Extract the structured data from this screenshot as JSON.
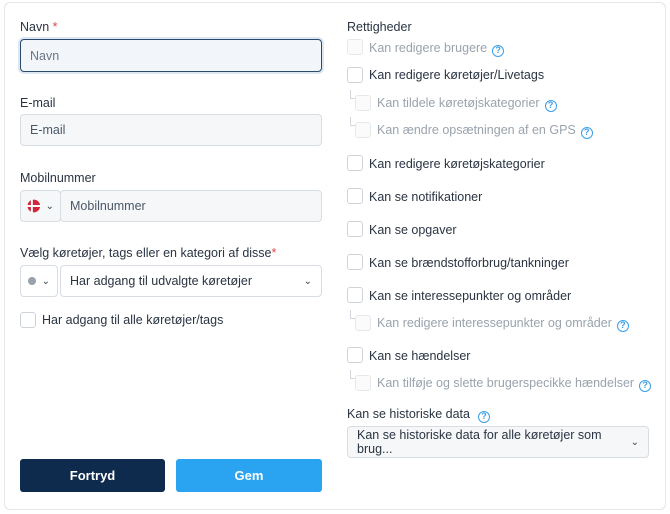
{
  "form": {
    "name": {
      "label": "Navn",
      "required_mark": "*",
      "placeholder": "Navn"
    },
    "email": {
      "label": "E-mail",
      "placeholder": "E-mail"
    },
    "mobile": {
      "label": "Mobilnummer",
      "placeholder": "Mobilnummer",
      "country_flag_icon": "denmark-flag-icon"
    },
    "vehicles": {
      "label": "Vælg køretøjer, tags eller en kategori af disse",
      "required_mark": "*",
      "status_dot_color": "#9aa3ad",
      "selected_option": "Har adgang til udvalgte køretøjer"
    },
    "all_vehicles_checkbox": {
      "label": "Har adgang til alle køretøjer/tags"
    },
    "buttons": {
      "cancel": "Fortryd",
      "save": "Gem"
    }
  },
  "permissions": {
    "title": "Rettigheder",
    "items": [
      {
        "label": "Kan redigere brugere",
        "disabled": true,
        "help": true
      },
      {
        "label": "Kan redigere køretøjer/Livetags",
        "disabled": false,
        "help": false
      },
      {
        "label": "Kan tildele køretøjskategorier",
        "disabled": true,
        "help": true
      },
      {
        "label": "Kan ændre opsætningen af en GPS",
        "disabled": true,
        "help": true
      },
      {
        "label": "Kan redigere køretøjskategorier",
        "disabled": false,
        "help": false
      },
      {
        "label": "Kan se notifikationer",
        "disabled": false,
        "help": false
      },
      {
        "label": "Kan se opgaver",
        "disabled": false,
        "help": false
      },
      {
        "label": "Kan se brændstofforbrug/tankninger",
        "disabled": false,
        "help": false
      },
      {
        "label": "Kan se interessepunkter og områder",
        "disabled": false,
        "help": false
      },
      {
        "label": "Kan redigere interessepunkter og områder",
        "disabled": true,
        "help": true
      },
      {
        "label": "Kan se hændelser",
        "disabled": false,
        "help": false
      },
      {
        "label": "Kan tilføje og slette brugerspecikke hændelser",
        "disabled": true,
        "help": true
      }
    ],
    "history": {
      "label": "Kan se historiske data",
      "selected_option": "Kan se historiske data for alle køretøjer som brug..."
    }
  },
  "colors": {
    "cancel_button": "#0e2a4d",
    "save_button": "#2aa3f0",
    "help_icon": "#3a9fe8",
    "required": "#e2474c"
  }
}
